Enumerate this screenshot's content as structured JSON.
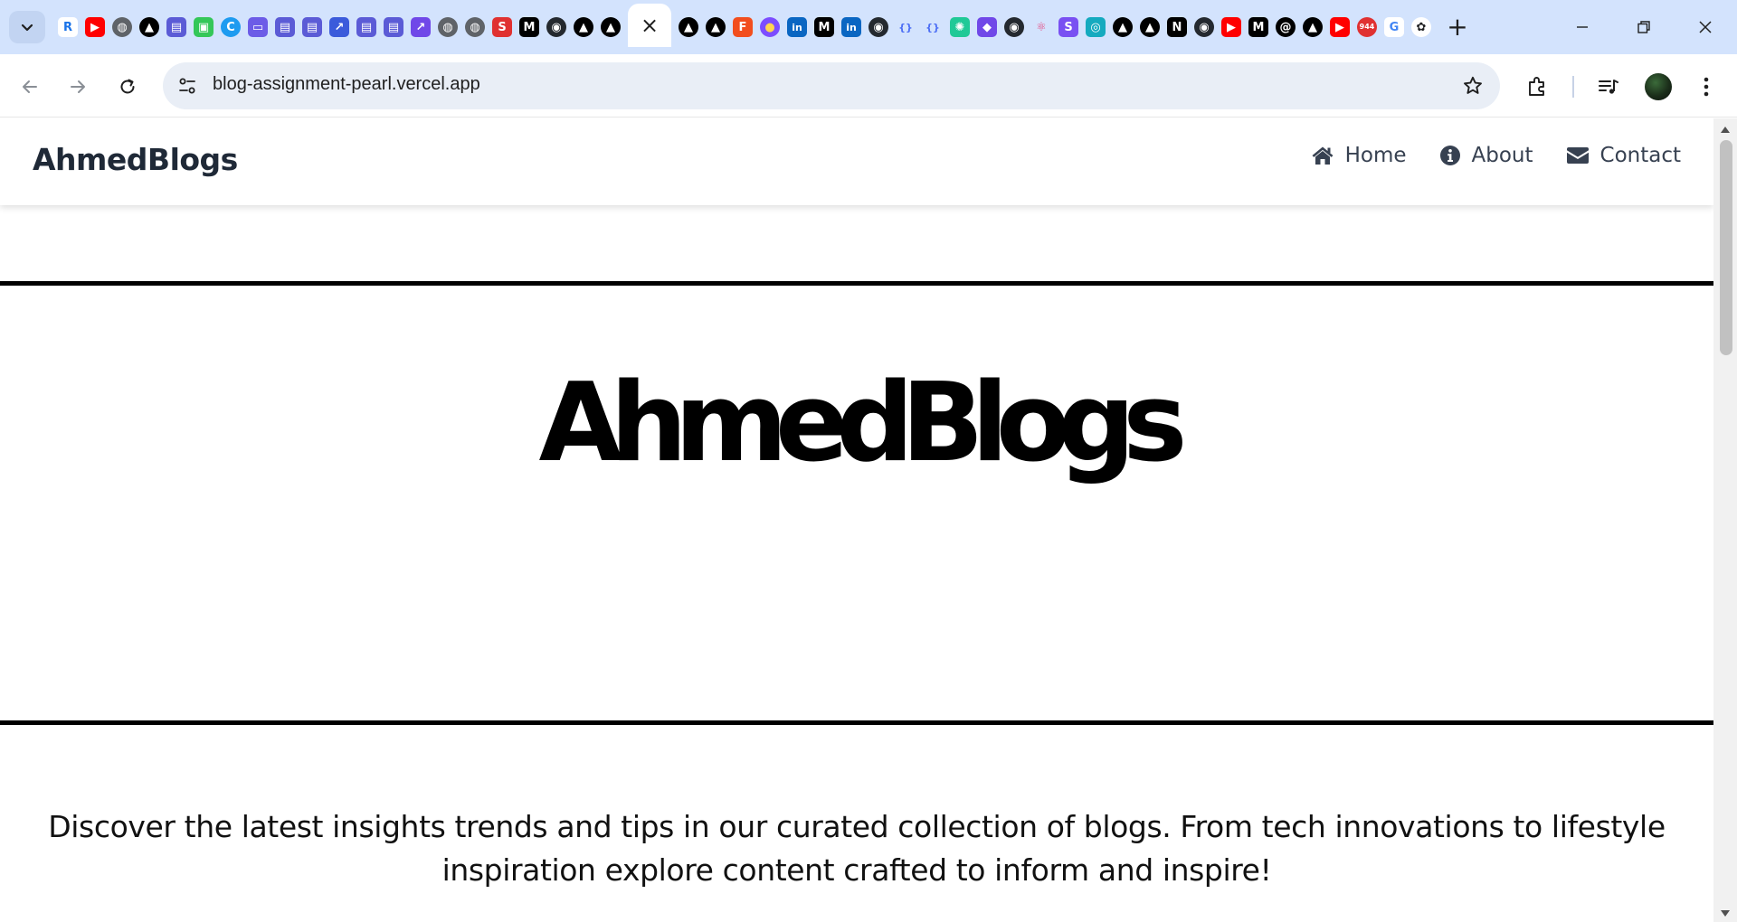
{
  "browser": {
    "url": "blog-assignment-pearl.vercel.app",
    "active_tab_close": "×",
    "new_tab": "+",
    "tabs_left": [
      {
        "icon": "r-icon",
        "text": "R",
        "bg": "#ffffff",
        "fg": "#1a73e8"
      },
      {
        "icon": "youtube-icon",
        "text": "▶",
        "bg": "#ff0000",
        "fg": "#ffffff"
      },
      {
        "icon": "globe-icon",
        "text": "◍",
        "bg": "#5f6368",
        "fg": "#ffffff"
      },
      {
        "icon": "vercel-icon",
        "text": "▲",
        "bg": "#000000",
        "fg": "#ffffff"
      },
      {
        "icon": "window-icon",
        "text": "▤",
        "bg": "#5b5bd6",
        "fg": "#ffffff"
      },
      {
        "icon": "frame-icon",
        "text": "▣",
        "bg": "#34c759",
        "fg": "#ffffff"
      },
      {
        "icon": "c-icon",
        "text": "C",
        "bg": "#1e9bf0",
        "fg": "#ffffff"
      },
      {
        "icon": "print-icon",
        "text": "▭",
        "bg": "#6c5ce7",
        "fg": "#ffffff"
      },
      {
        "icon": "window-icon",
        "text": "▤",
        "bg": "#5b5bd6",
        "fg": "#ffffff"
      },
      {
        "icon": "window-icon",
        "text": "▤",
        "bg": "#5b5bd6",
        "fg": "#ffffff"
      },
      {
        "icon": "shortcut-icon",
        "text": "↗",
        "bg": "#3b5bdb",
        "fg": "#ffffff"
      },
      {
        "icon": "window-icon",
        "text": "▤",
        "bg": "#5b5bd6",
        "fg": "#ffffff"
      },
      {
        "icon": "window-icon",
        "text": "▤",
        "bg": "#5b5bd6",
        "fg": "#ffffff"
      },
      {
        "icon": "shortcut-icon",
        "text": "↗",
        "bg": "#7048e8",
        "fg": "#ffffff"
      },
      {
        "icon": "globe-icon",
        "text": "◍",
        "bg": "#5f6368",
        "fg": "#ffffff"
      },
      {
        "icon": "globe-icon",
        "text": "◍",
        "bg": "#5f6368",
        "fg": "#ffffff"
      },
      {
        "icon": "s-icon",
        "text": "S",
        "bg": "#e03131",
        "fg": "#ffffff"
      },
      {
        "icon": "medium-icon",
        "text": "M",
        "bg": "#000000",
        "fg": "#ffffff"
      },
      {
        "icon": "github-icon",
        "text": "◉",
        "bg": "#24292f",
        "fg": "#ffffff"
      },
      {
        "icon": "vercel-icon",
        "text": "▲",
        "bg": "#000000",
        "fg": "#ffffff"
      },
      {
        "icon": "vercel-icon",
        "text": "▲",
        "bg": "#000000",
        "fg": "#ffffff"
      }
    ],
    "tabs_right": [
      {
        "icon": "vercel-icon",
        "text": "▲",
        "bg": "#000000",
        "fg": "#ffffff"
      },
      {
        "icon": "vercel-icon",
        "text": "▲",
        "bg": "#000000",
        "fg": "#ffffff"
      },
      {
        "icon": "figma-icon",
        "text": "F",
        "bg": "#f24e1e",
        "fg": "#ffffff"
      },
      {
        "icon": "avatar-icon",
        "text": "●",
        "bg": "#7c4dff",
        "fg": "#ffd54f"
      },
      {
        "icon": "linkedin-icon",
        "text": "in",
        "bg": "#0a66c2",
        "fg": "#ffffff"
      },
      {
        "icon": "medium-icon",
        "text": "M",
        "bg": "#000000",
        "fg": "#ffffff"
      },
      {
        "icon": "linkedin-icon",
        "text": "in",
        "bg": "#0a66c2",
        "fg": "#ffffff"
      },
      {
        "icon": "github-icon",
        "text": "◉",
        "bg": "#24292f",
        "fg": "#ffffff"
      },
      {
        "icon": "braces-icon",
        "text": "{}",
        "bg": "#d3e3fd",
        "fg": "#4c6ef5"
      },
      {
        "icon": "braces-icon",
        "text": "{}",
        "bg": "#d3e3fd",
        "fg": "#4c6ef5"
      },
      {
        "icon": "gear-icon",
        "text": "✺",
        "bg": "#20c997",
        "fg": "#ffffff"
      },
      {
        "icon": "shield-icon",
        "text": "◆",
        "bg": "#7048e8",
        "fg": "#ffffff"
      },
      {
        "icon": "github-icon",
        "text": "◉",
        "bg": "#24292f",
        "fg": "#ffffff"
      },
      {
        "icon": "react-icon",
        "text": "⚛",
        "bg": "#d3e3fd",
        "fg": "#e64980"
      },
      {
        "icon": "s-icon",
        "text": "S",
        "bg": "#7950f2",
        "fg": "#ffffff"
      },
      {
        "icon": "map-pin-icon",
        "text": "◎",
        "bg": "#15aabf",
        "fg": "#ffffff"
      },
      {
        "icon": "vercel-icon",
        "text": "▲",
        "bg": "#000000",
        "fg": "#ffffff"
      },
      {
        "icon": "vercel-icon",
        "text": "▲",
        "bg": "#000000",
        "fg": "#ffffff"
      },
      {
        "icon": "nextjs-icon",
        "text": "N",
        "bg": "#000000",
        "fg": "#ffffff"
      },
      {
        "icon": "github-icon",
        "text": "◉",
        "bg": "#24292f",
        "fg": "#ffffff"
      },
      {
        "icon": "youtube-icon",
        "text": "▶",
        "bg": "#ff0000",
        "fg": "#ffffff"
      },
      {
        "icon": "medium-icon",
        "text": "M",
        "bg": "#000000",
        "fg": "#ffffff"
      },
      {
        "icon": "ai-icon",
        "text": "@",
        "bg": "#000000",
        "fg": "#ffffff"
      },
      {
        "icon": "vercel-icon",
        "text": "▲",
        "bg": "#000000",
        "fg": "#ffffff"
      },
      {
        "icon": "youtube-icon",
        "text": "▶",
        "bg": "#ff0000",
        "fg": "#ffffff"
      },
      {
        "icon": "badge-944-icon",
        "text": "944",
        "bg": "#e03131",
        "fg": "#ffffff"
      },
      {
        "icon": "google-icon",
        "text": "G",
        "bg": "#ffffff",
        "fg": "#4285f4"
      },
      {
        "icon": "openai-icon",
        "text": "✿",
        "bg": "#ffffff",
        "fg": "#202123"
      }
    ]
  },
  "site": {
    "brand": "AhmedBlogs",
    "nav": [
      {
        "label": "Home",
        "icon": "home-icon"
      },
      {
        "label": "About",
        "icon": "info-icon"
      },
      {
        "label": "Contact",
        "icon": "envelope-icon"
      }
    ],
    "hero_title": "AhmedBlogs",
    "tagline": "Discover the latest insights trends and tips in our curated collection of blogs. From tech innovations to lifestyle inspiration explore content crafted to inform and inspire!"
  }
}
